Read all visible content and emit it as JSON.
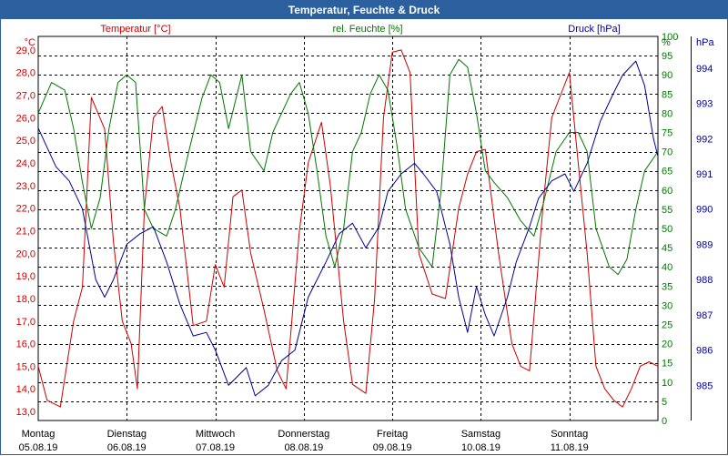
{
  "window": {
    "title": "Temperatur, Feuchte & Druck"
  },
  "colors": {
    "temperature": "#cc0000",
    "humidity": "#007700",
    "pressure": "#000099",
    "title_bg": "#2c5f9e",
    "grid": "#000000"
  },
  "chart_data": {
    "type": "line",
    "grid": true,
    "legend_placement": "top",
    "x": {
      "ticks": [
        {
          "day": "Montag",
          "date": "05.08.19"
        },
        {
          "day": "Dienstag",
          "date": "06.08.19"
        },
        {
          "day": "Mittwoch",
          "date": "07.08.19"
        },
        {
          "day": "Donnerstag",
          "date": "08.08.19"
        },
        {
          "day": "Freitag",
          "date": "09.08.19"
        },
        {
          "day": "Samstag",
          "date": "10.08.19"
        },
        {
          "day": "Sonntag",
          "date": "11.08.19"
        }
      ],
      "range": [
        "05.08.19 00:00",
        "12.08.19 00:00"
      ]
    },
    "axes": {
      "temperature": {
        "unit_label": "°C",
        "ylim": [
          12.6,
          29.6
        ],
        "ticks": [
          "13,0",
          "14,0",
          "15,0",
          "16,0",
          "17,0",
          "18,0",
          "19,0",
          "20,0",
          "21,0",
          "22,0",
          "23,0",
          "24,0",
          "25,0",
          "26,0",
          "27,0",
          "28,0",
          "29,0"
        ]
      },
      "humidity": {
        "unit_label": "%",
        "ylim": [
          0,
          100
        ],
        "ticks": [
          "0",
          "5",
          "10",
          "15",
          "20",
          "25",
          "30",
          "35",
          "40",
          "45",
          "50",
          "55",
          "60",
          "65",
          "70",
          "75",
          "80",
          "85",
          "90",
          "95",
          "100"
        ]
      },
      "pressure": {
        "unit_label": "hPa",
        "ylim": [
          984.0,
          994.9
        ],
        "ticks": [
          "985",
          "986",
          "987",
          "988",
          "989",
          "990",
          "991",
          "992",
          "993",
          "994"
        ]
      }
    },
    "series": [
      {
        "name": "Temperatur [°C]",
        "axis": "temperature",
        "x_days": [
          0,
          0.1,
          0.25,
          0.4,
          0.5,
          0.6,
          0.75,
          0.85,
          0.95,
          1.05,
          1.12,
          1.2,
          1.3,
          1.4,
          1.5,
          1.6,
          1.75,
          1.9,
          2.0,
          2.1,
          2.2,
          2.3,
          2.4,
          2.55,
          2.7,
          2.8,
          2.95,
          3.05,
          3.2,
          3.3,
          3.45,
          3.55,
          3.7,
          3.8,
          3.9,
          4.0,
          4.1,
          4.2,
          4.3,
          4.45,
          4.6,
          4.75,
          4.85,
          4.95,
          5.05,
          5.2,
          5.35,
          5.45,
          5.55,
          5.7,
          5.8,
          5.9,
          6.0,
          6.1,
          6.2,
          6.3,
          6.4,
          6.5,
          6.6,
          6.7,
          6.8,
          6.9,
          7.0
        ],
        "values": [
          15.0,
          13.5,
          13.2,
          17.0,
          18.5,
          26.9,
          25.5,
          20.5,
          17.0,
          16.0,
          14.0,
          22.0,
          26.0,
          26.5,
          24.0,
          22.0,
          16.8,
          17.0,
          19.5,
          18.5,
          22.5,
          22.8,
          20.0,
          17.5,
          14.8,
          14.0,
          21.0,
          24.0,
          25.8,
          23.0,
          17.0,
          14.2,
          13.8,
          18.0,
          26.0,
          28.9,
          29.0,
          28.0,
          20.0,
          18.2,
          18.0,
          22.0,
          23.5,
          24.5,
          24.6,
          20.0,
          16.0,
          15.0,
          14.8,
          22.0,
          26.0,
          27.0,
          28.0,
          24.0,
          20.0,
          15.0,
          14.0,
          13.5,
          13.2,
          14.0,
          15.0,
          15.2,
          15.0
        ]
      },
      {
        "name": "rel. Feuchte [%]",
        "axis": "humidity",
        "x_days": [
          0,
          0.15,
          0.3,
          0.4,
          0.5,
          0.6,
          0.7,
          0.8,
          0.9,
          1.0,
          1.1,
          1.2,
          1.3,
          1.45,
          1.55,
          1.7,
          1.85,
          1.95,
          2.05,
          2.15,
          2.3,
          2.4,
          2.55,
          2.65,
          2.75,
          2.85,
          2.95,
          3.05,
          3.15,
          3.25,
          3.35,
          3.45,
          3.55,
          3.65,
          3.75,
          3.85,
          3.95,
          4.05,
          4.15,
          4.3,
          4.45,
          4.55,
          4.65,
          4.75,
          4.85,
          4.95,
          5.05,
          5.15,
          5.3,
          5.45,
          5.6,
          5.7,
          5.85,
          6.0,
          6.1,
          6.2,
          6.3,
          6.45,
          6.55,
          6.65,
          6.75,
          6.85,
          7.0
        ],
        "values": [
          80,
          88,
          86,
          76,
          62,
          50,
          58,
          76,
          88,
          90,
          88,
          55,
          50,
          48,
          55,
          70,
          84,
          90,
          88,
          76,
          90,
          70,
          65,
          75,
          80,
          85,
          88,
          80,
          65,
          48,
          40,
          50,
          70,
          75,
          85,
          90,
          86,
          72,
          55,
          45,
          40,
          60,
          90,
          94,
          92,
          80,
          65,
          62,
          58,
          52,
          48,
          56,
          70,
          75,
          75,
          70,
          50,
          40,
          38,
          42,
          55,
          65,
          70
        ]
      },
      {
        "name": "Druck [hPa]",
        "axis": "pressure",
        "x_days": [
          0,
          0.2,
          0.35,
          0.5,
          0.65,
          0.75,
          0.85,
          1.0,
          1.15,
          1.3,
          1.45,
          1.6,
          1.75,
          1.9,
          2.0,
          2.15,
          2.35,
          2.45,
          2.6,
          2.75,
          2.9,
          3.05,
          3.25,
          3.4,
          3.55,
          3.7,
          3.85,
          3.95,
          4.1,
          4.25,
          4.35,
          4.5,
          4.65,
          4.75,
          4.85,
          4.95,
          5.05,
          5.15,
          5.3,
          5.4,
          5.55,
          5.65,
          5.8,
          5.95,
          6.05,
          6.2,
          6.35,
          6.5,
          6.6,
          6.75,
          6.85,
          6.95,
          7.0
        ],
        "values": [
          992.3,
          991.2,
          990.8,
          990.0,
          988.0,
          987.5,
          988.0,
          989.0,
          989.3,
          989.5,
          988.5,
          987.3,
          986.4,
          986.5,
          986.0,
          985.0,
          985.5,
          984.7,
          985.0,
          985.7,
          986.0,
          987.5,
          988.5,
          989.3,
          989.6,
          988.9,
          989.5,
          990.5,
          991.0,
          991.3,
          991.0,
          990.5,
          989.0,
          987.5,
          986.5,
          987.8,
          987.0,
          986.4,
          987.5,
          988.5,
          989.5,
          990.3,
          990.8,
          991.0,
          990.5,
          991.3,
          992.5,
          993.3,
          993.8,
          994.2,
          993.5,
          992.0,
          991.5
        ]
      }
    ]
  }
}
